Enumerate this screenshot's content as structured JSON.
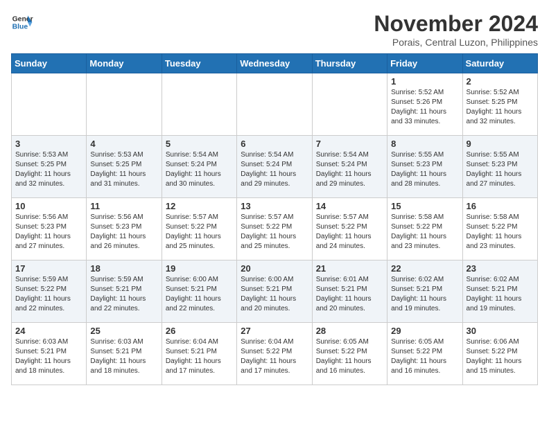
{
  "header": {
    "logo_line1": "General",
    "logo_line2": "Blue",
    "month": "November 2024",
    "location": "Porais, Central Luzon, Philippines"
  },
  "days_of_week": [
    "Sunday",
    "Monday",
    "Tuesday",
    "Wednesday",
    "Thursday",
    "Friday",
    "Saturday"
  ],
  "weeks": [
    [
      {
        "day": "",
        "info": ""
      },
      {
        "day": "",
        "info": ""
      },
      {
        "day": "",
        "info": ""
      },
      {
        "day": "",
        "info": ""
      },
      {
        "day": "",
        "info": ""
      },
      {
        "day": "1",
        "info": "Sunrise: 5:52 AM\nSunset: 5:26 PM\nDaylight: 11 hours and 33 minutes."
      },
      {
        "day": "2",
        "info": "Sunrise: 5:52 AM\nSunset: 5:25 PM\nDaylight: 11 hours and 32 minutes."
      }
    ],
    [
      {
        "day": "3",
        "info": "Sunrise: 5:53 AM\nSunset: 5:25 PM\nDaylight: 11 hours and 32 minutes."
      },
      {
        "day": "4",
        "info": "Sunrise: 5:53 AM\nSunset: 5:25 PM\nDaylight: 11 hours and 31 minutes."
      },
      {
        "day": "5",
        "info": "Sunrise: 5:54 AM\nSunset: 5:24 PM\nDaylight: 11 hours and 30 minutes."
      },
      {
        "day": "6",
        "info": "Sunrise: 5:54 AM\nSunset: 5:24 PM\nDaylight: 11 hours and 29 minutes."
      },
      {
        "day": "7",
        "info": "Sunrise: 5:54 AM\nSunset: 5:24 PM\nDaylight: 11 hours and 29 minutes."
      },
      {
        "day": "8",
        "info": "Sunrise: 5:55 AM\nSunset: 5:23 PM\nDaylight: 11 hours and 28 minutes."
      },
      {
        "day": "9",
        "info": "Sunrise: 5:55 AM\nSunset: 5:23 PM\nDaylight: 11 hours and 27 minutes."
      }
    ],
    [
      {
        "day": "10",
        "info": "Sunrise: 5:56 AM\nSunset: 5:23 PM\nDaylight: 11 hours and 27 minutes."
      },
      {
        "day": "11",
        "info": "Sunrise: 5:56 AM\nSunset: 5:23 PM\nDaylight: 11 hours and 26 minutes."
      },
      {
        "day": "12",
        "info": "Sunrise: 5:57 AM\nSunset: 5:22 PM\nDaylight: 11 hours and 25 minutes."
      },
      {
        "day": "13",
        "info": "Sunrise: 5:57 AM\nSunset: 5:22 PM\nDaylight: 11 hours and 25 minutes."
      },
      {
        "day": "14",
        "info": "Sunrise: 5:57 AM\nSunset: 5:22 PM\nDaylight: 11 hours and 24 minutes."
      },
      {
        "day": "15",
        "info": "Sunrise: 5:58 AM\nSunset: 5:22 PM\nDaylight: 11 hours and 23 minutes."
      },
      {
        "day": "16",
        "info": "Sunrise: 5:58 AM\nSunset: 5:22 PM\nDaylight: 11 hours and 23 minutes."
      }
    ],
    [
      {
        "day": "17",
        "info": "Sunrise: 5:59 AM\nSunset: 5:22 PM\nDaylight: 11 hours and 22 minutes."
      },
      {
        "day": "18",
        "info": "Sunrise: 5:59 AM\nSunset: 5:21 PM\nDaylight: 11 hours and 22 minutes."
      },
      {
        "day": "19",
        "info": "Sunrise: 6:00 AM\nSunset: 5:21 PM\nDaylight: 11 hours and 22 minutes."
      },
      {
        "day": "20",
        "info": "Sunrise: 6:00 AM\nSunset: 5:21 PM\nDaylight: 11 hours and 20 minutes."
      },
      {
        "day": "21",
        "info": "Sunrise: 6:01 AM\nSunset: 5:21 PM\nDaylight: 11 hours and 20 minutes."
      },
      {
        "day": "22",
        "info": "Sunrise: 6:02 AM\nSunset: 5:21 PM\nDaylight: 11 hours and 19 minutes."
      },
      {
        "day": "23",
        "info": "Sunrise: 6:02 AM\nSunset: 5:21 PM\nDaylight: 11 hours and 19 minutes."
      }
    ],
    [
      {
        "day": "24",
        "info": "Sunrise: 6:03 AM\nSunset: 5:21 PM\nDaylight: 11 hours and 18 minutes."
      },
      {
        "day": "25",
        "info": "Sunrise: 6:03 AM\nSunset: 5:21 PM\nDaylight: 11 hours and 18 minutes."
      },
      {
        "day": "26",
        "info": "Sunrise: 6:04 AM\nSunset: 5:21 PM\nDaylight: 11 hours and 17 minutes."
      },
      {
        "day": "27",
        "info": "Sunrise: 6:04 AM\nSunset: 5:22 PM\nDaylight: 11 hours and 17 minutes."
      },
      {
        "day": "28",
        "info": "Sunrise: 6:05 AM\nSunset: 5:22 PM\nDaylight: 11 hours and 16 minutes."
      },
      {
        "day": "29",
        "info": "Sunrise: 6:05 AM\nSunset: 5:22 PM\nDaylight: 11 hours and 16 minutes."
      },
      {
        "day": "30",
        "info": "Sunrise: 6:06 AM\nSunset: 5:22 PM\nDaylight: 11 hours and 15 minutes."
      }
    ]
  ]
}
